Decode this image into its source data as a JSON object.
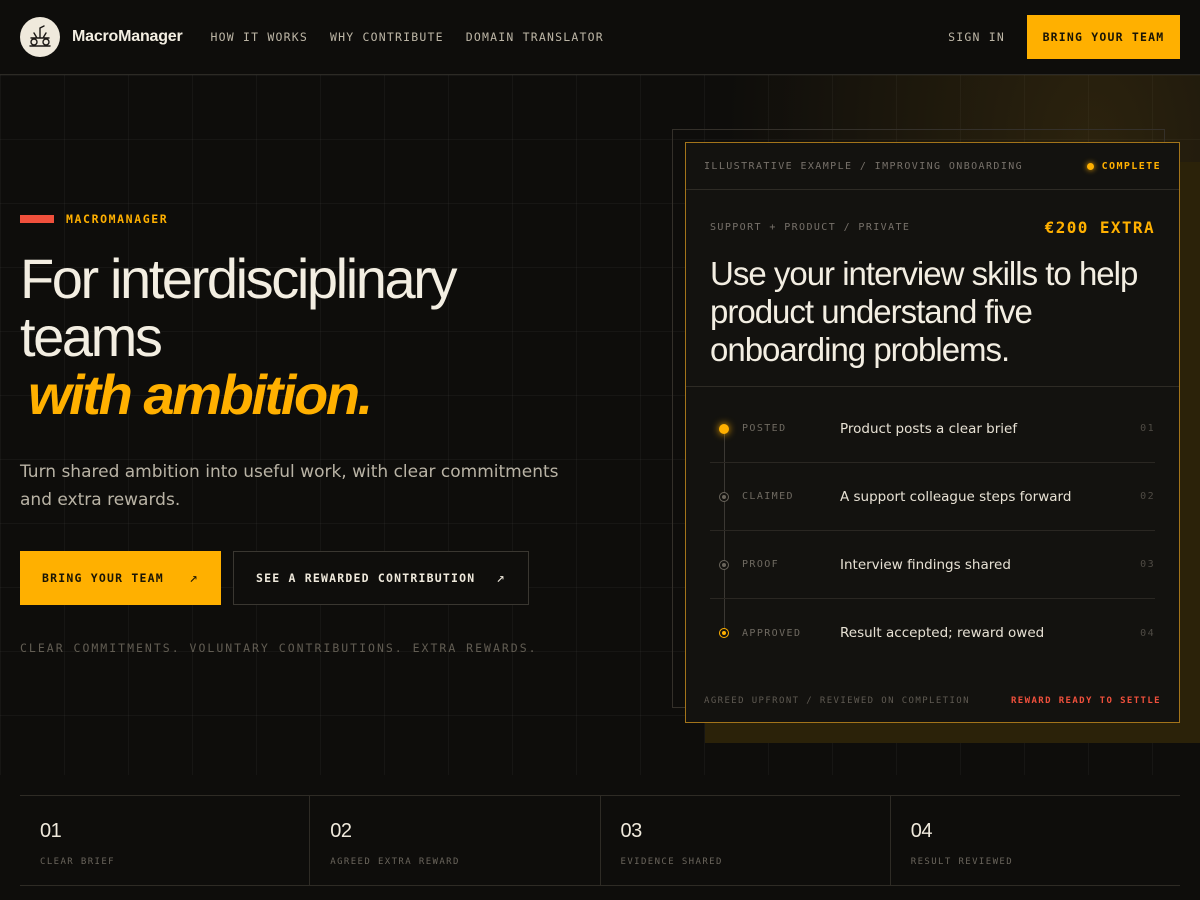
{
  "header": {
    "brand": "MacroManager",
    "logo_icon": "ant-rider-logo-icon",
    "nav": [
      "HOW IT WORKS",
      "WHY CONTRIBUTE",
      "DOMAIN TRANSLATOR"
    ],
    "sign_in": "SIGN IN",
    "cta": "BRING YOUR TEAM"
  },
  "hero": {
    "eyebrow": "MACROMANAGER",
    "title_line1": "For interdisciplinary",
    "title_line2": "teams",
    "title_accent": "with ambition.",
    "subtitle": "Turn shared ambition into useful work, with clear commitments and extra rewards.",
    "cta_primary": "BRING YOUR TEAM",
    "cta_secondary": "SEE A REWARDED CONTRIBUTION",
    "arrow_glyph": "↗",
    "tagline": "CLEAR COMMITMENTS. VOLUNTARY CONTRIBUTIONS. EXTRA REWARDS."
  },
  "card": {
    "header_label": "ILLUSTRATIVE EXAMPLE / IMPROVING ONBOARDING",
    "status": "COMPLETE",
    "meta": "SUPPORT + PRODUCT / PRIVATE",
    "reward": "€200 EXTRA",
    "title": "Use your interview skills to help product understand five onboarding problems.",
    "steps": [
      {
        "status": "POSTED",
        "text": "Product posts a clear brief",
        "num": "01"
      },
      {
        "status": "CLAIMED",
        "text": "A support colleague steps forward",
        "num": "02"
      },
      {
        "status": "PROOF",
        "text": "Interview findings shared",
        "num": "03"
      },
      {
        "status": "APPROVED",
        "text": "Result accepted; reward owed",
        "num": "04"
      }
    ],
    "footer_left": "AGREED UPFRONT / REVIEWED ON COMPLETION",
    "footer_right": "REWARD READY TO SETTLE"
  },
  "stats": [
    {
      "num": "01",
      "label": "CLEAR BRIEF"
    },
    {
      "num": "02",
      "label": "AGREED EXTRA REWARD"
    },
    {
      "num": "03",
      "label": "EVIDENCE SHARED"
    },
    {
      "num": "04",
      "label": "RESULT REVIEWED"
    }
  ],
  "colors": {
    "accent": "#ffb000",
    "alert": "#f0503c",
    "background": "#0e0d0b"
  }
}
